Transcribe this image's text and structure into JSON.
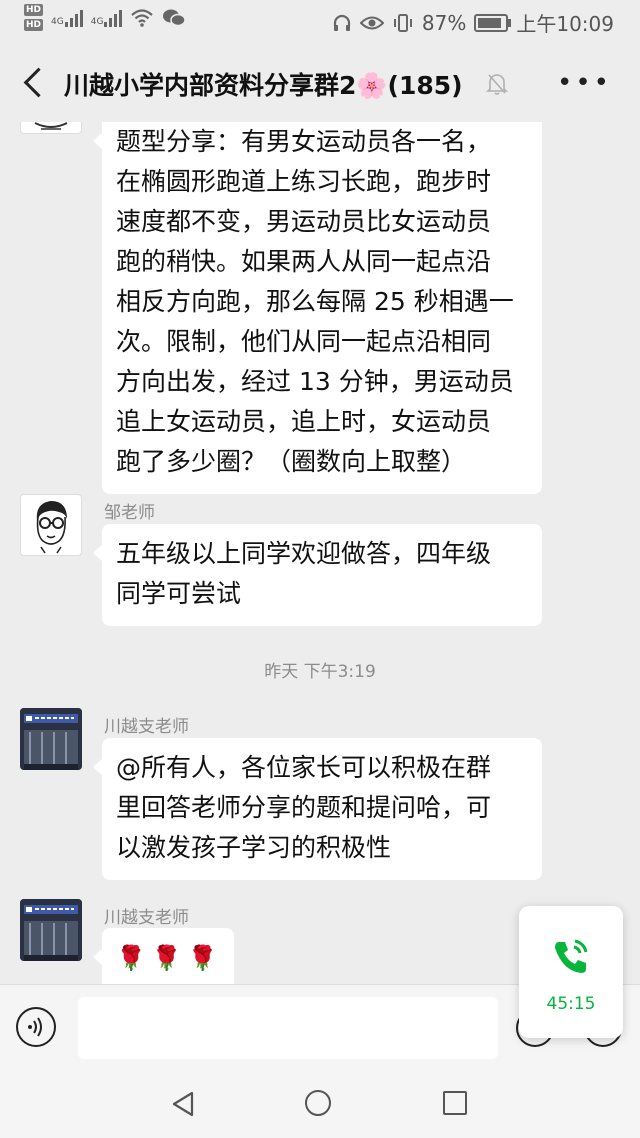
{
  "status_bar": {
    "hd1": "HD",
    "hd2": "HD",
    "net1": "4G",
    "net2": "4G",
    "battery": "87%",
    "time": "上午10:09"
  },
  "header": {
    "title": "川越小学内部资料分享群2🌸(185)"
  },
  "messages": [
    {
      "type": "text",
      "lines": [
        "题型分享：有男女运动员各一名，",
        "在椭圆形跑道上练习长跑，跑步时",
        "速度都不变，男运动员比女运动员",
        "跑的稍快。如果两人从同一起点沿",
        "相反方向跑，那么每隔 25 秒相遇一",
        "次。限制，他们从同一起点沿相同",
        "方向出发，经过 13 分钟，男运动员",
        "追上女运动员，追上时，女运动员",
        "跑了多少圈？（圈数向上取整）"
      ]
    },
    {
      "type": "text",
      "sender": "邹老师",
      "lines": [
        "五年级以上同学欢迎做答，四年级",
        "同学可尝试"
      ]
    },
    {
      "type": "time",
      "text": "昨天 下午3:19"
    },
    {
      "type": "text",
      "sender": "川越支老师",
      "lines": [
        "@所有人，各位家长可以积极在群",
        "里回答老师分享的题和提问哈，可",
        "以激发孩子学习的积极性"
      ]
    },
    {
      "type": "emoji",
      "sender": "川越支老师",
      "text": "🌹🌹🌹"
    }
  ],
  "call": {
    "duration": "45:15",
    "color": "#07b53b"
  },
  "colors": {
    "background": "#ededed",
    "bubble": "#ffffff",
    "sender": "#8c8c8c"
  },
  "icons": {
    "back": "chevron-left-icon",
    "mute": "bell-off-icon",
    "more": "more-icon",
    "voice": "voice-input-icon",
    "phone": "phone-call-icon"
  }
}
